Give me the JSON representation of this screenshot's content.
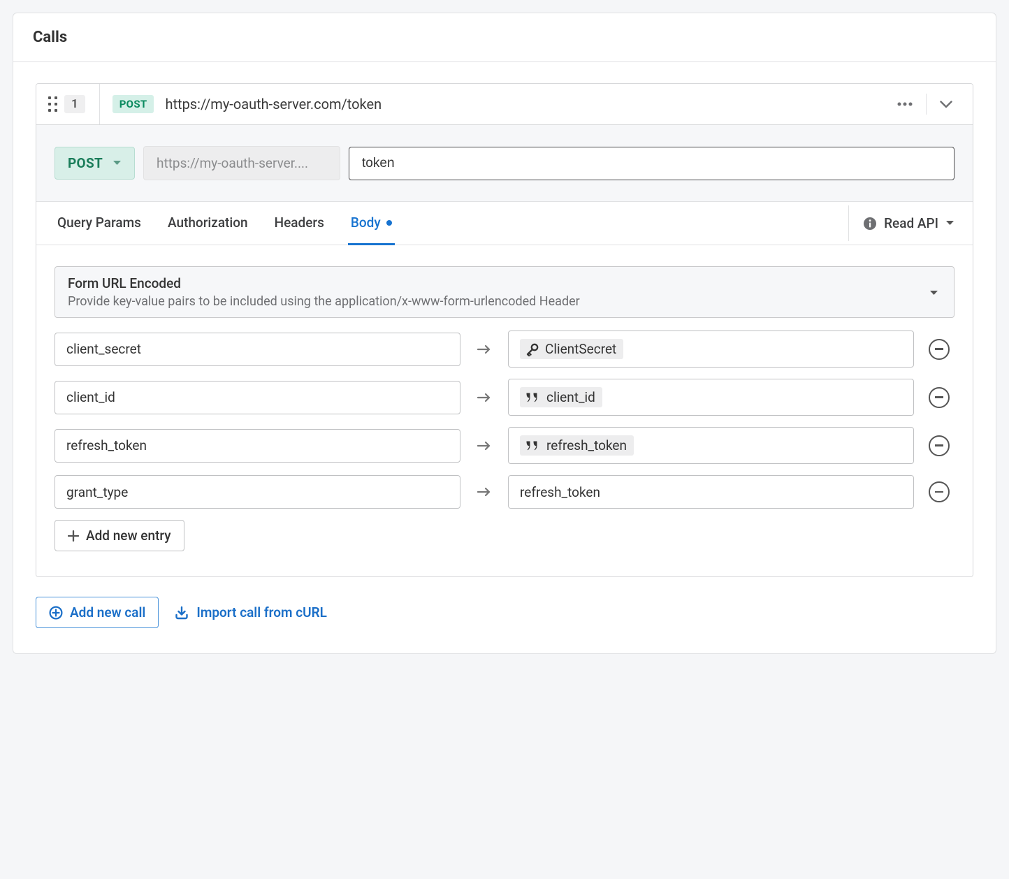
{
  "panel_title": "Calls",
  "call": {
    "index": "1",
    "method": "POST",
    "full_url": "https://my-oauth-server.com/token",
    "base_url_display": "https://my-oauth-server....",
    "path_value": "token"
  },
  "tabs": {
    "query_params": "Query Params",
    "authorization": "Authorization",
    "headers": "Headers",
    "body": "Body"
  },
  "read_api_label": "Read API",
  "body_encoding": {
    "title": "Form URL Encoded",
    "description": "Provide key-value pairs to be included using the application/x-www-form-urlencoded Header"
  },
  "body_params": [
    {
      "key": "client_secret",
      "value_type": "secret",
      "value_label": "ClientSecret"
    },
    {
      "key": "client_id",
      "value_type": "var",
      "value_label": "client_id"
    },
    {
      "key": "refresh_token",
      "value_type": "var",
      "value_label": "refresh_token"
    },
    {
      "key": "grant_type",
      "value_type": "literal",
      "value_label": "refresh_token"
    }
  ],
  "add_entry_label": "Add new entry",
  "footer": {
    "add_call": "Add new call",
    "import_curl": "Import call from cURL"
  },
  "colors": {
    "accent_blue": "#1773d0",
    "method_green": "#0a8a5f"
  }
}
